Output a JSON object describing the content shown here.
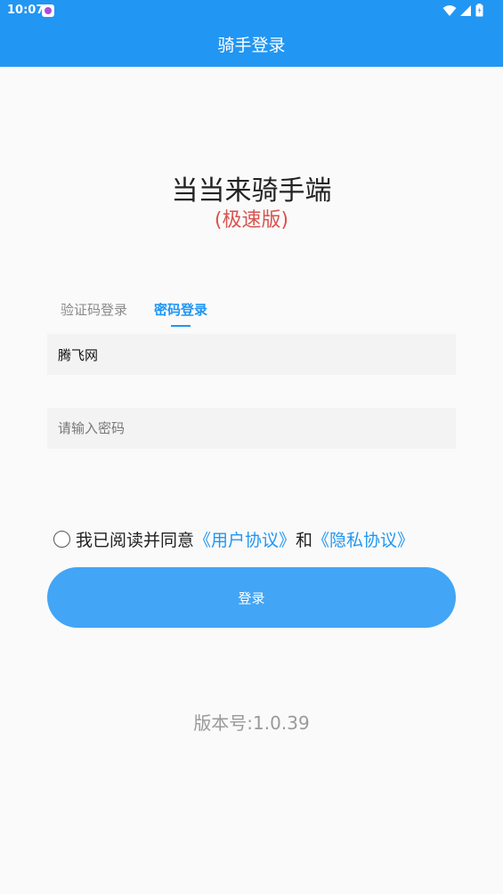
{
  "status_bar": {
    "time": "10:07",
    "notification_icon": "app-notification-icon",
    "icons": [
      "wifi-icon",
      "signal-icon",
      "battery-icon"
    ]
  },
  "header": {
    "title": "骑手登录",
    "background_color": "#2196f3"
  },
  "app": {
    "name": "当当来骑手端",
    "subtitle": "(极速版)"
  },
  "tabs": [
    {
      "label": "验证码登录",
      "active": false
    },
    {
      "label": "密码登录",
      "active": true
    }
  ],
  "form": {
    "username_value": "腾飞网",
    "password_placeholder": "请输入密码"
  },
  "agreement": {
    "checked": false,
    "prefix": "我已阅读并同意",
    "user_agreement": "《用户协议》",
    "and": "和",
    "privacy_policy": "《隐私协议》"
  },
  "login_button": {
    "label": "登录"
  },
  "version": "版本号:1.0.39",
  "colors": {
    "accent": "#2196f3",
    "button": "#42a5f5",
    "subtitle": "#d9534f"
  }
}
